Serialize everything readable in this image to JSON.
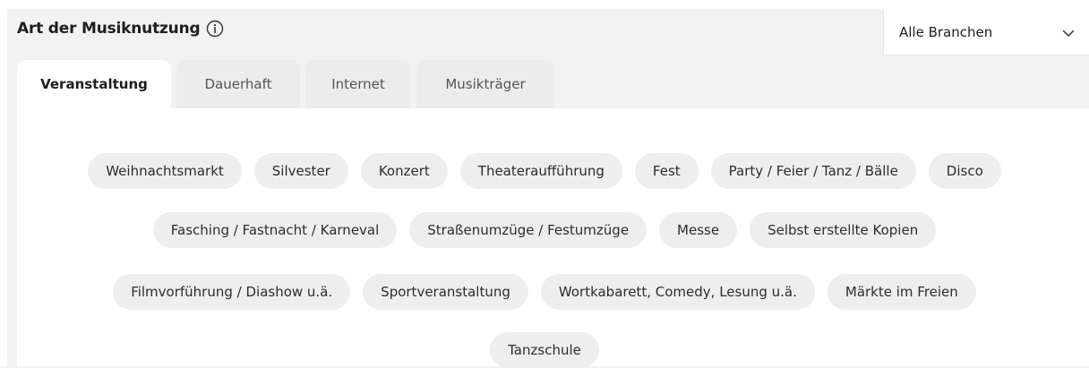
{
  "header": {
    "title": "Art der Musiknutzung"
  },
  "filter": {
    "selected": "Alle Branchen"
  },
  "tabs": [
    {
      "label": "Veranstaltung",
      "active": true
    },
    {
      "label": "Dauerhaft",
      "active": false
    },
    {
      "label": "Internet",
      "active": false
    },
    {
      "label": "Musikträger",
      "active": false
    }
  ],
  "chips": {
    "row1": [
      "Weihnachtsmarkt",
      "Silvester",
      "Konzert",
      "Theateraufführung",
      "Fest",
      "Party / Feier / Tanz / Bälle",
      "Disco"
    ],
    "row2": [
      "Fasching / Fastnacht / Karneval",
      "Straßenumzüge / Festumzüge",
      "Messe",
      "Selbst erstellte Kopien"
    ],
    "row3": [
      "Filmvorführung / Diashow u.ä.",
      "Sportveranstaltung",
      "Wortkabarett, Comedy, Lesung u.ä.",
      "Märkte im Freien"
    ],
    "row4": [
      "Tanzschule"
    ]
  },
  "icons": {
    "info": "info-circle-icon",
    "dropdown": "chevron-down-icon"
  }
}
